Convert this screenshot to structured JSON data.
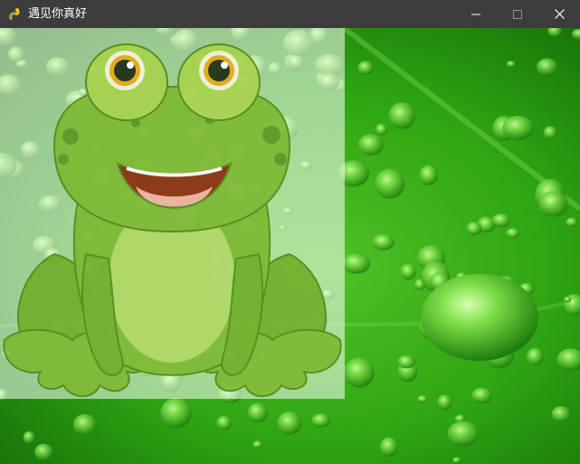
{
  "window": {
    "title": "遇见你真好",
    "icon": "pygame-snake-icon",
    "controls": [
      "minimize-icon",
      "maximize-icon",
      "close-icon"
    ]
  },
  "scene": {
    "background": "green-leaf-water-drops",
    "sprite": "cartoon-frog",
    "colors": {
      "titlebar": "#3c3c3c",
      "leaf_dark": "#1f8a0e",
      "leaf_light": "#58c42c",
      "frog_body": "#7db832",
      "frog_dark": "#5a9620"
    }
  }
}
